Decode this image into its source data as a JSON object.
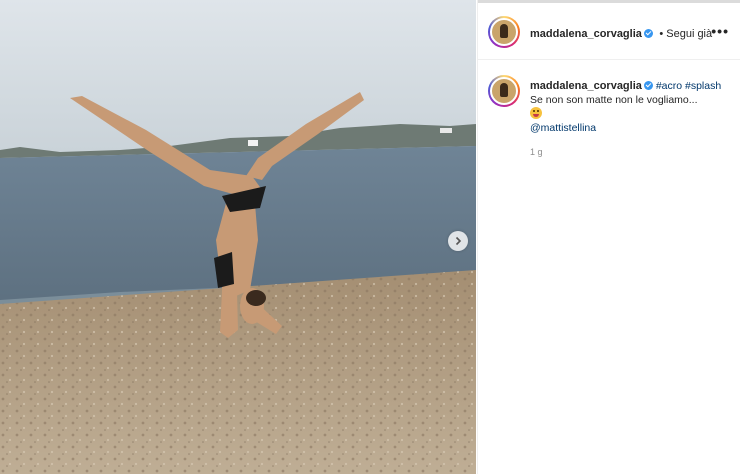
{
  "post": {
    "author": "maddalena_corvaglia",
    "follow_status": "• Segui già",
    "more_label": "•••",
    "caption": {
      "hashtags": "#acro #splash",
      "text": "Se non son matte non le vogliamo...",
      "mention": "@mattistellina"
    },
    "timestamp": "1 g"
  },
  "icons": {
    "verified": "verified-badge-icon",
    "more": "more-options-icon",
    "carousel": "chevron-right-icon",
    "emoji": "tongue-face-emoji-icon"
  },
  "colors": {
    "link": "#00376b",
    "verified": "#3897f0",
    "muted": "#8e8e8e"
  }
}
